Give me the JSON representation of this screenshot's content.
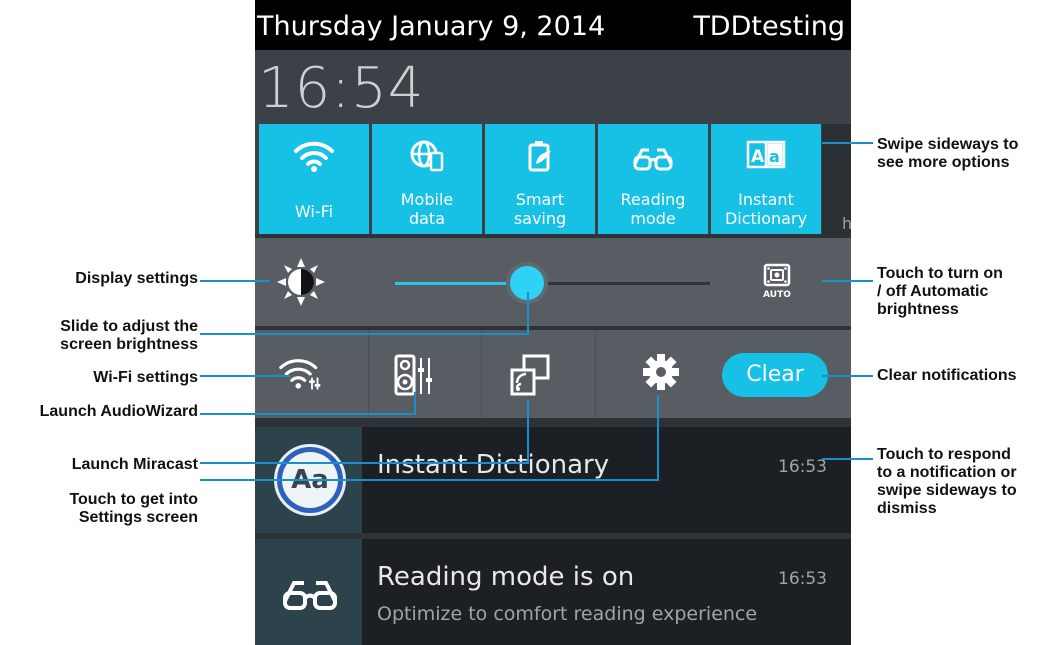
{
  "status_bar": {
    "date": "Thursday January 9, 2014",
    "carrier": "TDDtesting"
  },
  "clock": "16:54",
  "quick_tiles": [
    {
      "icon": "wifi-icon",
      "label_line1": "Wi-Fi",
      "label_line2": ""
    },
    {
      "icon": "mobile-data-icon",
      "label_line1": "Mobile",
      "label_line2": "data"
    },
    {
      "icon": "smart-saving-icon",
      "label_line1": "Smart",
      "label_line2": "saving"
    },
    {
      "icon": "reading-mode-icon",
      "label_line1": "Reading",
      "label_line2": "mode"
    },
    {
      "icon": "dictionary-icon",
      "label_line1": "Instant",
      "label_line2": "Dictionary"
    }
  ],
  "next_tile_peek": "h",
  "brightness": {
    "level": 0.42,
    "auto_label": "AUTO"
  },
  "quick_settings": {
    "clear_label": "Clear"
  },
  "notifications": [
    {
      "title": "Instant Dictionary",
      "time": "16:53",
      "subtitle": "",
      "icon_text": "Aa"
    },
    {
      "title": "Reading mode is on",
      "time": "16:53",
      "subtitle": "Optimize to comfort reading experience"
    }
  ],
  "callouts": {
    "swipe_sideways_1": "Swipe sideways to",
    "swipe_sideways_2": "see more options",
    "display_settings": "Display settings",
    "auto_bright_1": "Touch to turn on",
    "auto_bright_2": "/ off Automatic",
    "auto_bright_3": "brightness",
    "slide_1": "Slide to adjust the",
    "slide_2": "screen brightness",
    "wifi_settings": "Wi-Fi settings",
    "clear_notifications": "Clear notifications",
    "audiowizard": "Launch AudioWizard",
    "miracast": "Launch Miracast",
    "respond_1": "Touch to respond",
    "respond_2": "to a notification or",
    "respond_3": "swipe sideways to",
    "respond_4": "dismiss",
    "settings_1": "Touch to get into",
    "settings_2": "Settings screen"
  },
  "colors": {
    "accent": "#16c1e5",
    "panel": "#575d62",
    "status_bar": "#000000"
  }
}
